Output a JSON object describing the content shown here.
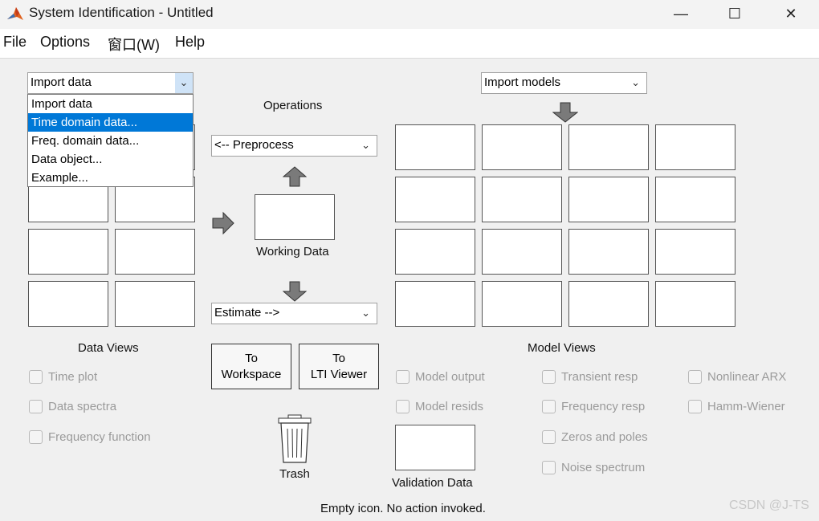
{
  "window": {
    "title": "System Identification - Untitled",
    "minimize_glyph": "—",
    "maximize_glyph": "☐",
    "close_glyph": "✕"
  },
  "menu": [
    "File",
    "Options",
    "窗口(W)",
    "Help"
  ],
  "import_data": {
    "selected": "Import data",
    "options": [
      "Import data",
      "Time domain data...",
      "Freq. domain data...",
      "Data object...",
      "Example..."
    ],
    "highlighted_index": 1
  },
  "import_models": {
    "selected": "Import models"
  },
  "operations": {
    "title": "Operations",
    "preprocess": "<-- Preprocess",
    "working_data": "Working Data",
    "estimate": "Estimate -->"
  },
  "buttons": {
    "to_workspace": [
      "To",
      "Workspace"
    ],
    "to_lti": [
      "To",
      "LTI Viewer"
    ]
  },
  "trash_label": "Trash",
  "validation_data": "Validation Data",
  "data_views": {
    "title": "Data Views",
    "items": [
      "Time plot",
      "Data spectra",
      "Frequency function"
    ]
  },
  "model_views": {
    "title": "Model Views",
    "col1": [
      "Model output",
      "Model resids"
    ],
    "col2": [
      "Transient resp",
      "Frequency resp",
      "Zeros and poles",
      "Noise spectrum"
    ],
    "col3": [
      "Nonlinear ARX",
      "Hamm-Wiener"
    ]
  },
  "status": "Empty icon. No action invoked.",
  "watermark": "CSDN @J-TS",
  "colors": {
    "selection": "#0078d7",
    "background": "#f0f0f0",
    "arrow": "#7a7a7a"
  }
}
